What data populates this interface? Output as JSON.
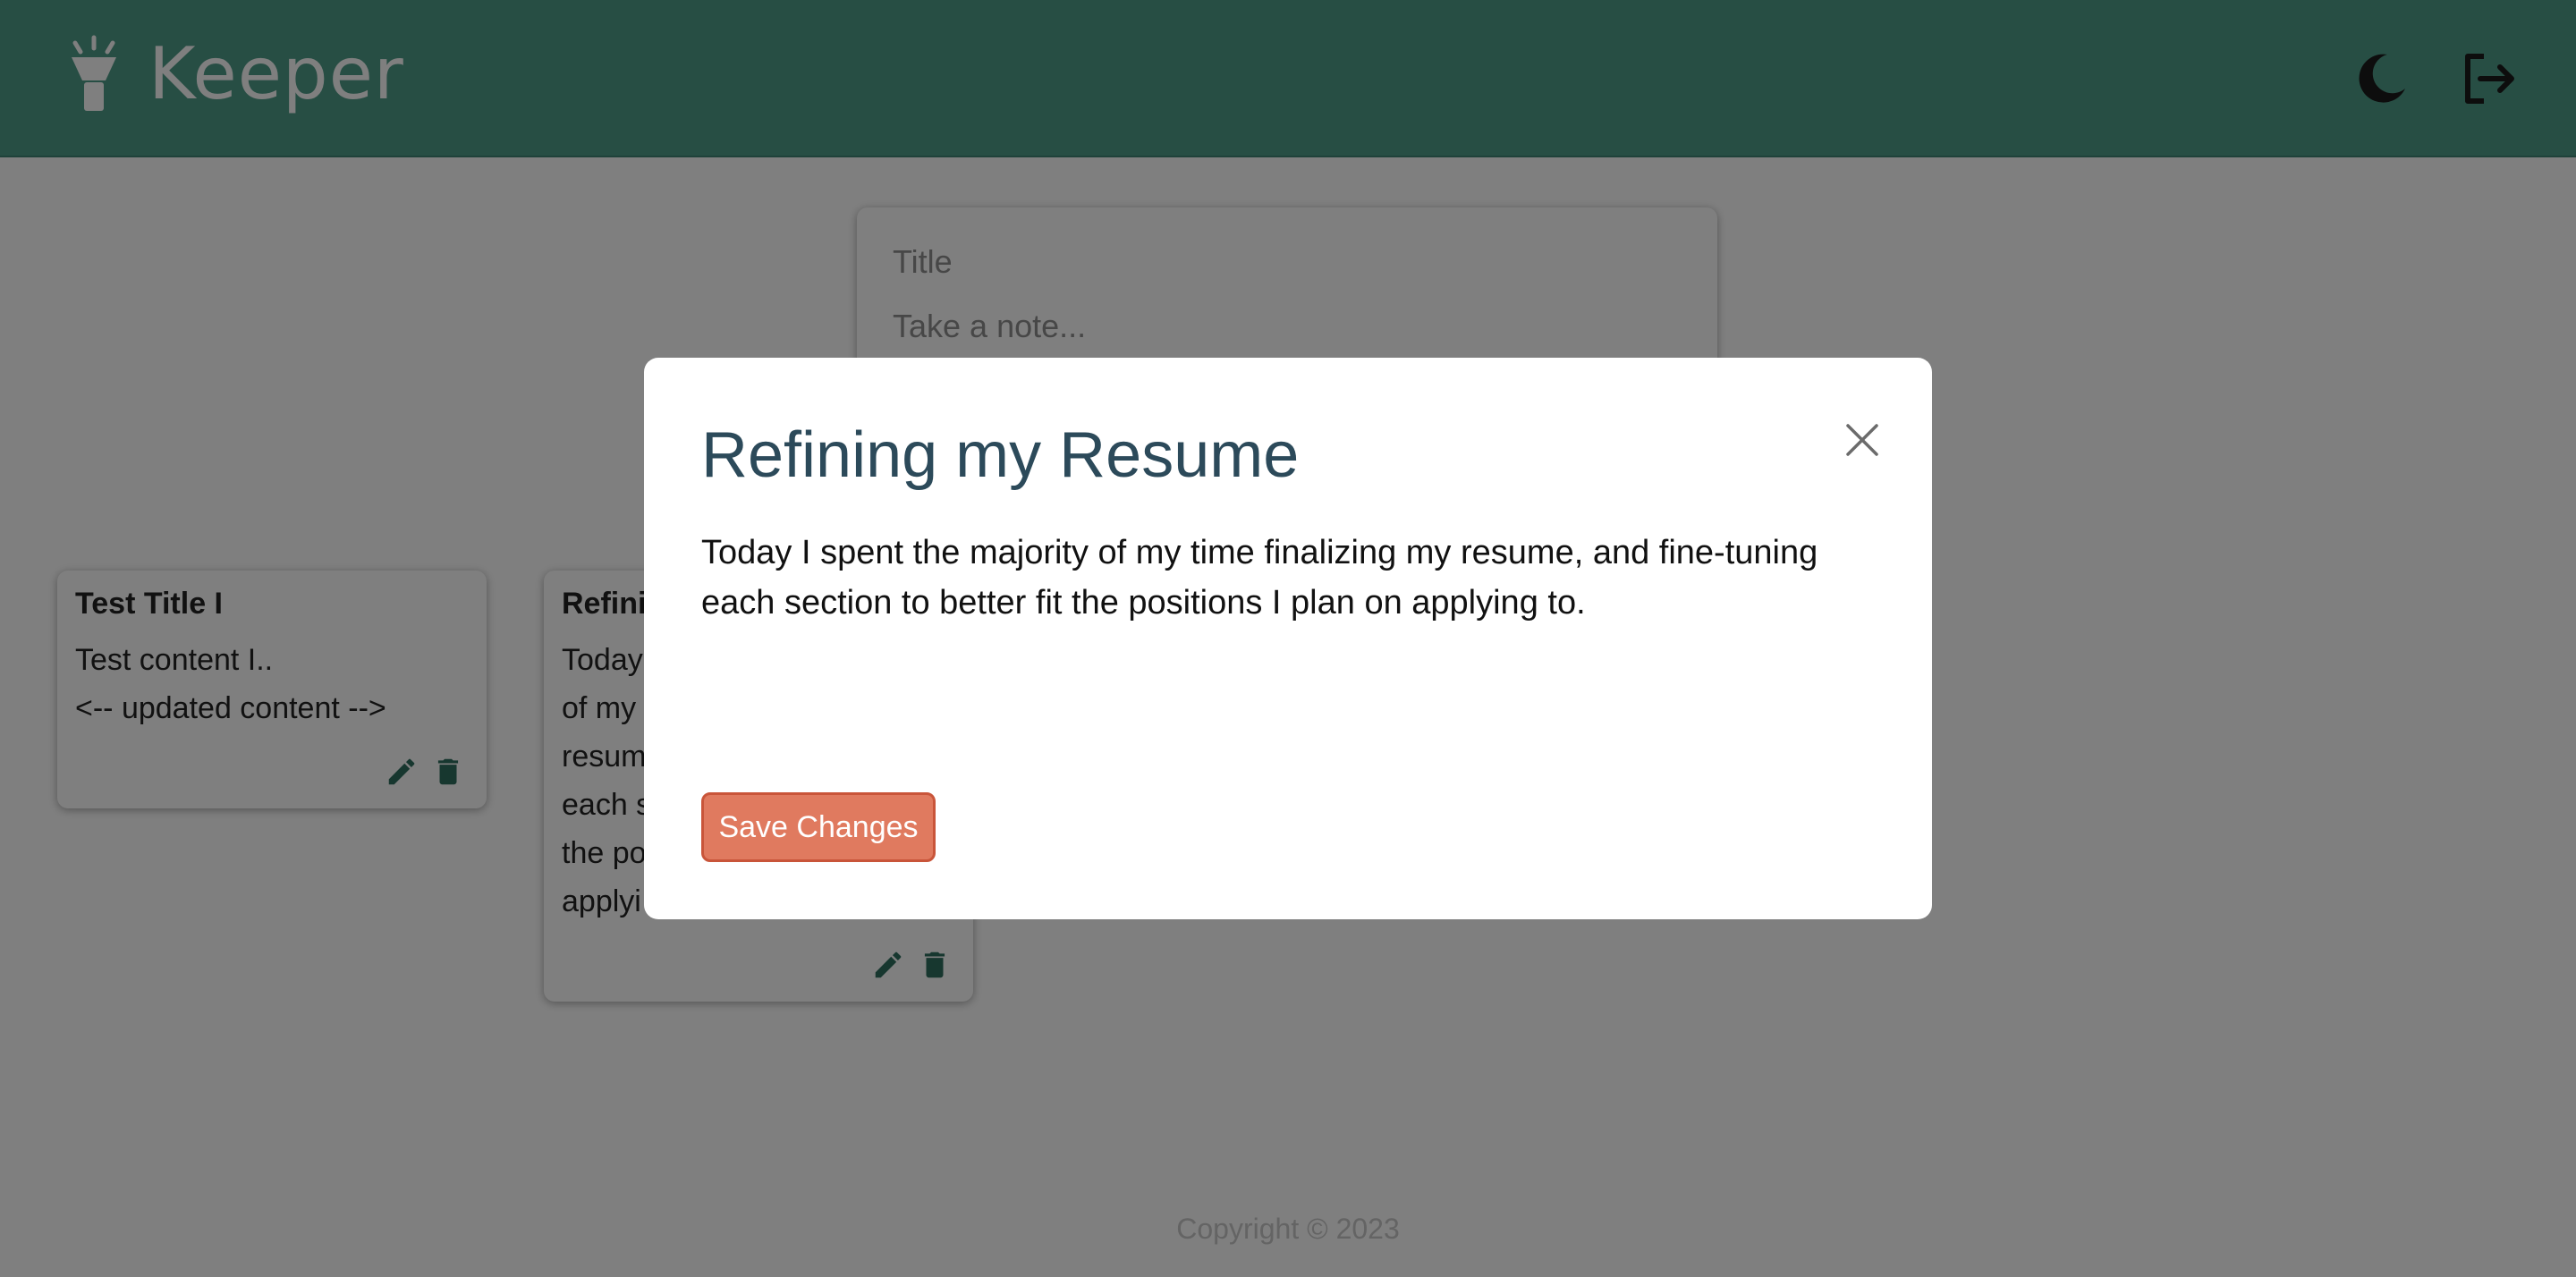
{
  "header": {
    "brand_title": "Keeper",
    "brand_icon": "flashlight-icon",
    "theme_icon": "moon-icon",
    "logout_icon": "logout-icon",
    "color": "#4f9c89"
  },
  "create_note": {
    "title_placeholder": "Title",
    "content_placeholder": "Take a note..."
  },
  "notes": [
    {
      "title": "Test Title I",
      "content": "Test content I..\n<-- updated content -->",
      "edit_icon": "pencil-icon",
      "delete_icon": "trash-icon"
    },
    {
      "title": "Refini",
      "content": "Today\nof my\nresum\neach s\nthe po\napplyi",
      "edit_icon": "pencil-icon",
      "delete_icon": "trash-icon"
    }
  ],
  "footer": {
    "copyright": "Copyright © 2023"
  },
  "modal": {
    "title": "Refining my Resume",
    "content": "Today I spent the majority of my time finalizing my resume, and fine-tuning each section to better fit the positions I plan on applying to.",
    "close_icon": "close-icon",
    "save_label": "Save Changes",
    "save_color": "#e07a5f",
    "title_color": "#2c4a5a"
  }
}
